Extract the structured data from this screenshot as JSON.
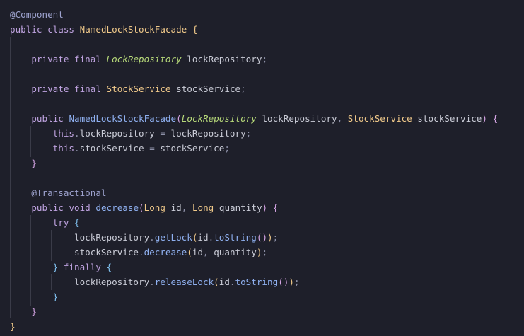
{
  "editor": {
    "code_lines": [
      {
        "tokens": [
          {
            "t": "@Component",
            "k": "ann"
          }
        ]
      },
      {
        "tokens": [
          {
            "t": "public",
            "k": "kw"
          },
          {
            "t": " "
          },
          {
            "t": "class",
            "k": "kw"
          },
          {
            "t": " "
          },
          {
            "t": "NamedLockStockFacade",
            "k": "cls"
          },
          {
            "t": " "
          },
          {
            "t": "{",
            "k": "b1"
          }
        ]
      },
      {
        "tokens": []
      },
      {
        "tokens": [
          {
            "t": "    "
          },
          {
            "t": "private",
            "k": "kw"
          },
          {
            "t": " "
          },
          {
            "t": "final",
            "k": "kw"
          },
          {
            "t": " "
          },
          {
            "t": "LockRepository",
            "k": "iface"
          },
          {
            "t": " "
          },
          {
            "t": "lockRepository",
            "k": "var"
          },
          {
            "t": ";",
            "k": "pu"
          }
        ]
      },
      {
        "tokens": []
      },
      {
        "tokens": [
          {
            "t": "    "
          },
          {
            "t": "private",
            "k": "kw"
          },
          {
            "t": " "
          },
          {
            "t": "final",
            "k": "kw"
          },
          {
            "t": " "
          },
          {
            "t": "StockService",
            "k": "cls"
          },
          {
            "t": " "
          },
          {
            "t": "stockService",
            "k": "var"
          },
          {
            "t": ";",
            "k": "pu"
          }
        ]
      },
      {
        "tokens": []
      },
      {
        "tokens": [
          {
            "t": "    "
          },
          {
            "t": "public",
            "k": "kw"
          },
          {
            "t": " "
          },
          {
            "t": "NamedLockStockFacade",
            "k": "fn"
          },
          {
            "t": "(",
            "k": "b2"
          },
          {
            "t": "LockRepository",
            "k": "iface"
          },
          {
            "t": " "
          },
          {
            "t": "lockRepository",
            "k": "var"
          },
          {
            "t": ",",
            "k": "pu"
          },
          {
            "t": " "
          },
          {
            "t": "StockService",
            "k": "cls"
          },
          {
            "t": " "
          },
          {
            "t": "stockService",
            "k": "var"
          },
          {
            "t": ")",
            "k": "b2"
          },
          {
            "t": " "
          },
          {
            "t": "{",
            "k": "b2"
          }
        ]
      },
      {
        "tokens": [
          {
            "t": "        "
          },
          {
            "t": "this",
            "k": "kw"
          },
          {
            "t": ".",
            "k": "pu"
          },
          {
            "t": "lockRepository",
            "k": "var"
          },
          {
            "t": " = ",
            "k": "pu"
          },
          {
            "t": "lockRepository",
            "k": "var"
          },
          {
            "t": ";",
            "k": "pu"
          }
        ]
      },
      {
        "tokens": [
          {
            "t": "        "
          },
          {
            "t": "this",
            "k": "kw"
          },
          {
            "t": ".",
            "k": "pu"
          },
          {
            "t": "stockService",
            "k": "var"
          },
          {
            "t": " = ",
            "k": "pu"
          },
          {
            "t": "stockService",
            "k": "var"
          },
          {
            "t": ";",
            "k": "pu"
          }
        ]
      },
      {
        "tokens": [
          {
            "t": "    "
          },
          {
            "t": "}",
            "k": "b2"
          }
        ]
      },
      {
        "tokens": []
      },
      {
        "tokens": [
          {
            "t": "    "
          },
          {
            "t": "@Transactional",
            "k": "ann"
          }
        ]
      },
      {
        "tokens": [
          {
            "t": "    "
          },
          {
            "t": "public",
            "k": "kw"
          },
          {
            "t": " "
          },
          {
            "t": "void",
            "k": "kw"
          },
          {
            "t": " "
          },
          {
            "t": "decrease",
            "k": "fn"
          },
          {
            "t": "(",
            "k": "b2"
          },
          {
            "t": "Long",
            "k": "cls"
          },
          {
            "t": " "
          },
          {
            "t": "id",
            "k": "var"
          },
          {
            "t": ",",
            "k": "pu"
          },
          {
            "t": " "
          },
          {
            "t": "Long",
            "k": "cls"
          },
          {
            "t": " "
          },
          {
            "t": "quantity",
            "k": "var"
          },
          {
            "t": ")",
            "k": "b2"
          },
          {
            "t": " "
          },
          {
            "t": "{",
            "k": "b2"
          }
        ]
      },
      {
        "tokens": [
          {
            "t": "        "
          },
          {
            "t": "try",
            "k": "kw"
          },
          {
            "t": " "
          },
          {
            "t": "{",
            "k": "b3"
          }
        ]
      },
      {
        "tokens": [
          {
            "t": "            "
          },
          {
            "t": "lockRepository",
            "k": "var"
          },
          {
            "t": ".",
            "k": "pu"
          },
          {
            "t": "getLock",
            "k": "fn"
          },
          {
            "t": "(",
            "k": "b1"
          },
          {
            "t": "id",
            "k": "var"
          },
          {
            "t": ".",
            "k": "pu"
          },
          {
            "t": "toString",
            "k": "fn"
          },
          {
            "t": "(",
            "k": "b2"
          },
          {
            "t": ")",
            "k": "b2"
          },
          {
            "t": ")",
            "k": "b1"
          },
          {
            "t": ";",
            "k": "pu"
          }
        ]
      },
      {
        "tokens": [
          {
            "t": "            "
          },
          {
            "t": "stockService",
            "k": "var"
          },
          {
            "t": ".",
            "k": "pu"
          },
          {
            "t": "decrease",
            "k": "fn"
          },
          {
            "t": "(",
            "k": "b1"
          },
          {
            "t": "id",
            "k": "var"
          },
          {
            "t": ",",
            "k": "pu"
          },
          {
            "t": " "
          },
          {
            "t": "quantity",
            "k": "var"
          },
          {
            "t": ")",
            "k": "b1"
          },
          {
            "t": ";",
            "k": "pu"
          }
        ]
      },
      {
        "tokens": [
          {
            "t": "        "
          },
          {
            "t": "}",
            "k": "b3"
          },
          {
            "t": " "
          },
          {
            "t": "finally",
            "k": "kw"
          },
          {
            "t": " "
          },
          {
            "t": "{",
            "k": "b3"
          }
        ]
      },
      {
        "tokens": [
          {
            "t": "            "
          },
          {
            "t": "lockRepository",
            "k": "var"
          },
          {
            "t": ".",
            "k": "pu"
          },
          {
            "t": "releaseLock",
            "k": "fn"
          },
          {
            "t": "(",
            "k": "b1"
          },
          {
            "t": "id",
            "k": "var"
          },
          {
            "t": ".",
            "k": "pu"
          },
          {
            "t": "toString",
            "k": "fn"
          },
          {
            "t": "(",
            "k": "b2"
          },
          {
            "t": ")",
            "k": "b2"
          },
          {
            "t": ")",
            "k": "b1"
          },
          {
            "t": ";",
            "k": "pu"
          }
        ]
      },
      {
        "tokens": [
          {
            "t": "        "
          },
          {
            "t": "}",
            "k": "b3"
          }
        ]
      },
      {
        "tokens": [
          {
            "t": "    "
          },
          {
            "t": "}",
            "k": "b2"
          }
        ]
      },
      {
        "tokens": [
          {
            "t": "}",
            "k": "b1"
          }
        ]
      }
    ]
  }
}
